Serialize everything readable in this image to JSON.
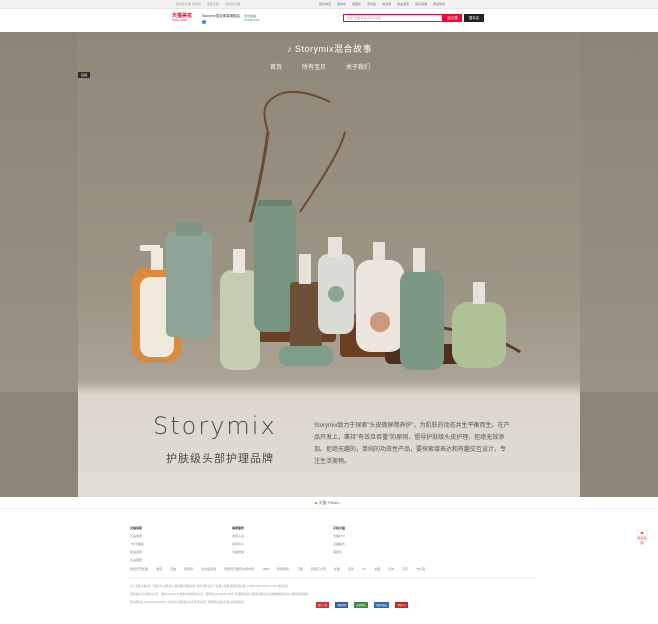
{
  "topbar": {
    "left": [
      "欢迎来天猫 请登录",
      "免费注册",
      "手机逛天猫"
    ],
    "right": [
      "我的淘宝",
      "购物车",
      "收藏夹",
      "手机版",
      "淘宝网",
      "我是卖家",
      "联系客服",
      "网站导航"
    ]
  },
  "header": {
    "logo": "天猫美妆",
    "logo_sub": "TMALL.COM",
    "store_name": "Storymix混合故事旗舰店",
    "store_tag": "混合故事 STORYMIX",
    "search_placeholder": "搜索 天猫 商品/品牌/店铺",
    "search_tmall": "搜天猫",
    "search_store": "搜本店"
  },
  "hero": {
    "brand": "Storymix混合故事",
    "brand_note": "♪",
    "nav": [
      "首页",
      "所有宝贝",
      "关于我们"
    ],
    "tag": "店铺",
    "title": "Storymix",
    "subtitle": "护肤级头部护理品牌",
    "description": "Storymix致力于探索\"头皮微屏障养护\"，为肌肤的动态共生平衡而生。在产品开发上，秉持\"有效且否重\"的原则，倡导护肤级头皮护理，拒绝无效添加。拒绝无趣的，单纯的功效性产品，要探索增表达和有趣交互设计，专注生活美物。"
  },
  "strip": {
    "logo": "天猫",
    "sub": "TMALL"
  },
  "footer": {
    "col1": {
      "head": "天猫保障",
      "items": [
        "正品保障",
        "7天无理由",
        "极速退款",
        "正品保障"
      ]
    },
    "col2": {
      "head": "商家服务",
      "items": [
        "商家入驻",
        "商家中心",
        "天猫智库"
      ]
    },
    "col3": {
      "head": "手机天猫",
      "items": [
        "天猫APP",
        "天猫超市",
        "喵鲜生"
      ]
    },
    "links": [
      "阿里巴巴集团",
      "淘宝",
      "天猫",
      "聚划算",
      "全球速卖通",
      "阿里巴巴国际交易市场",
      "1688",
      "阿里妈妈",
      "飞猪",
      "阿里云计算",
      "优酷",
      "高德",
      "UC",
      "友盟",
      "虾米",
      "钉钉",
      "支付宝"
    ],
    "lines": [
      "关于天猫   帮助中心   开放平台   诚聘英才   联系我们   网站合作   法律声明   知识产权   廉正举报   规则意见征集   © 2003-2024 TMALL.COM 版权所有",
      "增值电信业务经营许可证：浙B2-20110446   网络文化经营许可证：浙网文[2021]3020-129号   互联网药品信息服务资格证书   出版物网络交易平台服务经营备案",
      "浙公网安备 33010002000120号   营业执照   增值电信业务经营许可证   互联网违法和不良信息举报电话"
    ],
    "badges": [
      "浙江工商",
      "网络警察",
      "诚信网站",
      "消费者维权",
      "举报中心"
    ],
    "help": "联系客服"
  }
}
